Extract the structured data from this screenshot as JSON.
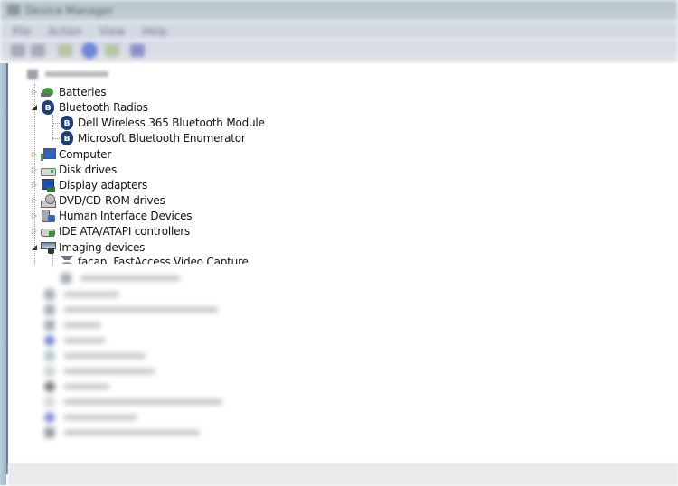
{
  "window": {
    "title": "Device Manager",
    "menu": [
      "File",
      "Action",
      "View",
      "Help"
    ]
  },
  "tree": {
    "root_label": "",
    "items": [
      {
        "label": "Batteries",
        "icon": "battery-icon",
        "expanded": false,
        "level": 1
      },
      {
        "label": "Bluetooth Radios",
        "icon": "bluetooth-icon",
        "expanded": true,
        "level": 1
      },
      {
        "label": "Dell Wireless 365 Bluetooth Module",
        "icon": "bluetooth-icon",
        "level": 2
      },
      {
        "label": "Microsoft Bluetooth Enumerator",
        "icon": "bluetooth-icon",
        "level": 2
      },
      {
        "label": "Computer",
        "icon": "computer-icon",
        "expanded": false,
        "level": 1
      },
      {
        "label": "Disk drives",
        "icon": "disk-drive-icon",
        "expanded": false,
        "level": 1
      },
      {
        "label": "Display adapters",
        "icon": "display-adapter-icon",
        "expanded": false,
        "level": 1
      },
      {
        "label": "DVD/CD-ROM drives",
        "icon": "dvd-drive-icon",
        "expanded": false,
        "level": 1
      },
      {
        "label": "Human Interface Devices",
        "icon": "hid-icon",
        "expanded": false,
        "level": 1
      },
      {
        "label": "IDE ATA/ATAPI controllers",
        "icon": "ide-controller-icon",
        "expanded": false,
        "level": 1
      },
      {
        "label": "Imaging devices",
        "icon": "imaging-device-icon",
        "expanded": true,
        "level": 1
      },
      {
        "label": "facap, FastAccess Video Capture",
        "icon": "webcam-icon",
        "level": 2
      }
    ],
    "expand_glyph": "▷",
    "collapse_glyph": "◢",
    "bluetooth_glyph": "ʙ"
  },
  "colors": {
    "text": "#111111",
    "bluetooth": "#1f3f7a",
    "frame": "#b8cfdc"
  }
}
